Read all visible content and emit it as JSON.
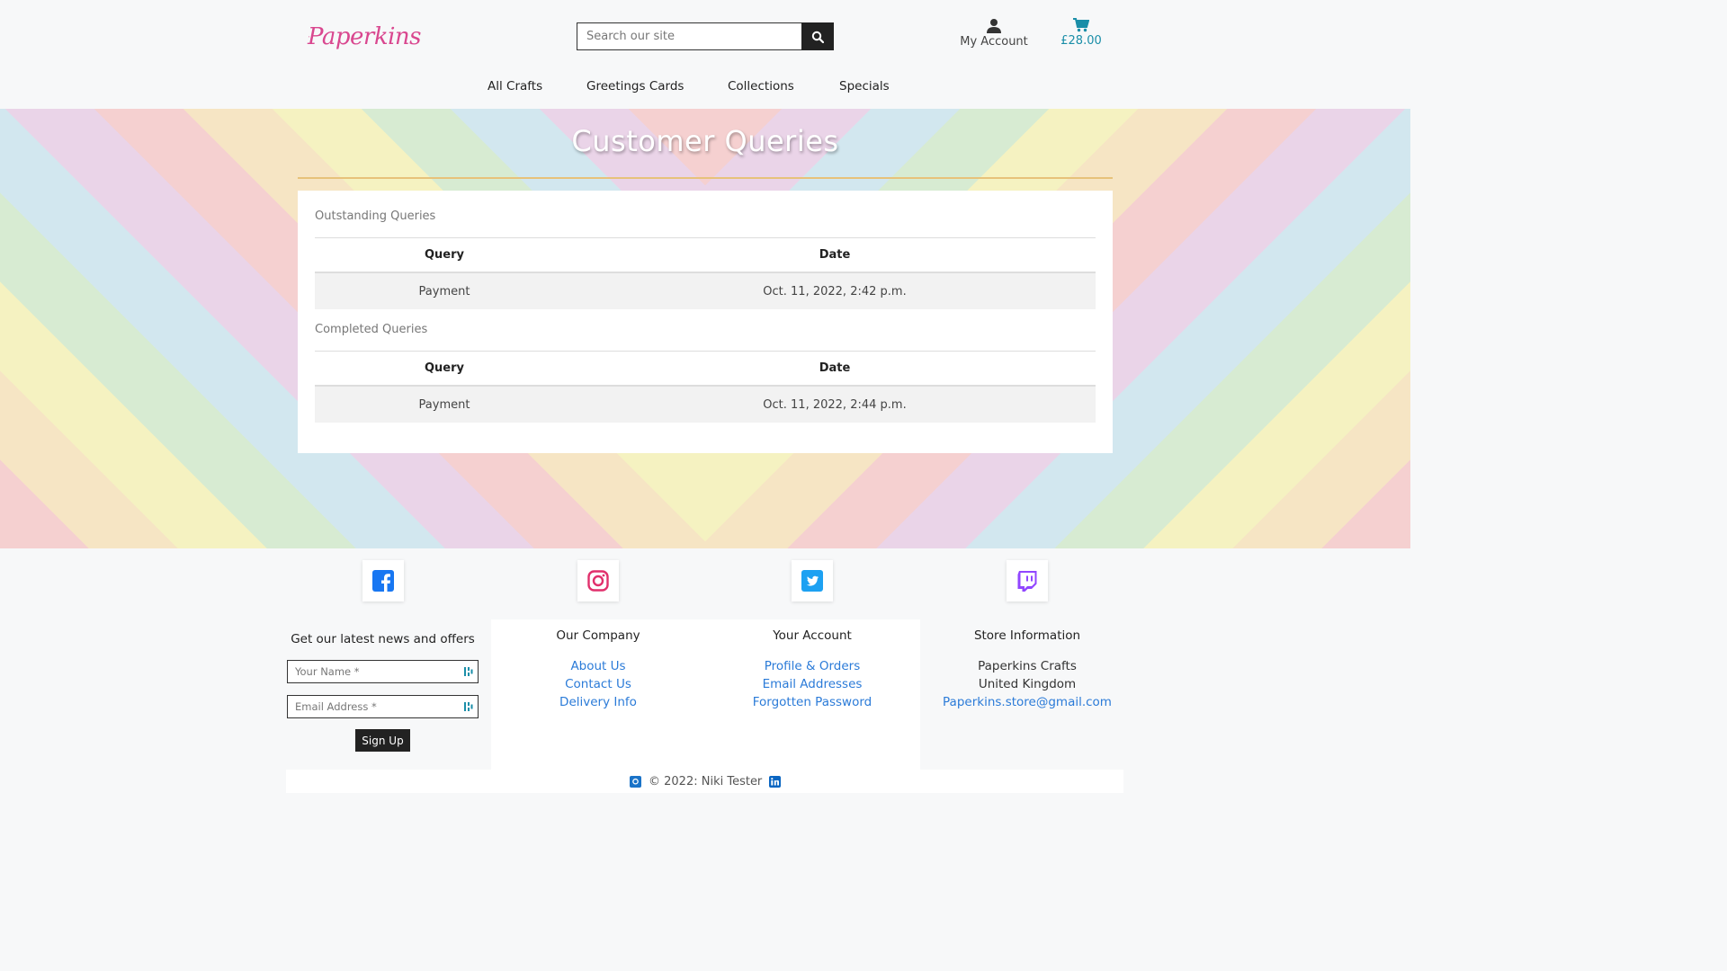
{
  "header": {
    "logo_text": "Paperkins",
    "search_placeholder": "Search our site",
    "account_label": "My Account",
    "cart_total": "£28.00"
  },
  "nav": [
    "All Crafts",
    "Greetings Cards",
    "Collections",
    "Specials"
  ],
  "page_title": "Customer Queries",
  "outstanding": {
    "label": "Outstanding Queries",
    "headers": [
      "Query",
      "Date"
    ],
    "rows": [
      {
        "query": "Payment",
        "date": "Oct. 11, 2022, 2:42 p.m."
      }
    ]
  },
  "completed": {
    "label": "Completed Queries",
    "headers": [
      "Query",
      "Date"
    ],
    "rows": [
      {
        "query": "Payment",
        "date": "Oct. 11, 2022, 2:44 p.m."
      }
    ]
  },
  "social": [
    "facebook-icon",
    "instagram-icon",
    "twitter-icon",
    "twitch-icon"
  ],
  "newsletter": {
    "title": "Get our latest news and offers",
    "name_placeholder": "Your Name *",
    "email_placeholder": "Email Address *",
    "button": "Sign Up"
  },
  "footer": {
    "company": {
      "title": "Our Company",
      "links": [
        "About Us",
        "Contact Us",
        "Delivery Info"
      ]
    },
    "account": {
      "title": "Your Account",
      "links": [
        "Profile & Orders",
        "Email Addresses",
        "Forgotten Password"
      ]
    },
    "store": {
      "title": "Store Information",
      "lines": [
        "Paperkins Crafts",
        "United Kingdom"
      ],
      "email": "Paperkins.store@gmail.com"
    },
    "copyright": "© 2022: Niki Tester"
  },
  "colors": {
    "accent": "#1a8ea8",
    "link": "#2b7bd8",
    "logo": "#d9478f",
    "rule": "#e7c27a"
  }
}
